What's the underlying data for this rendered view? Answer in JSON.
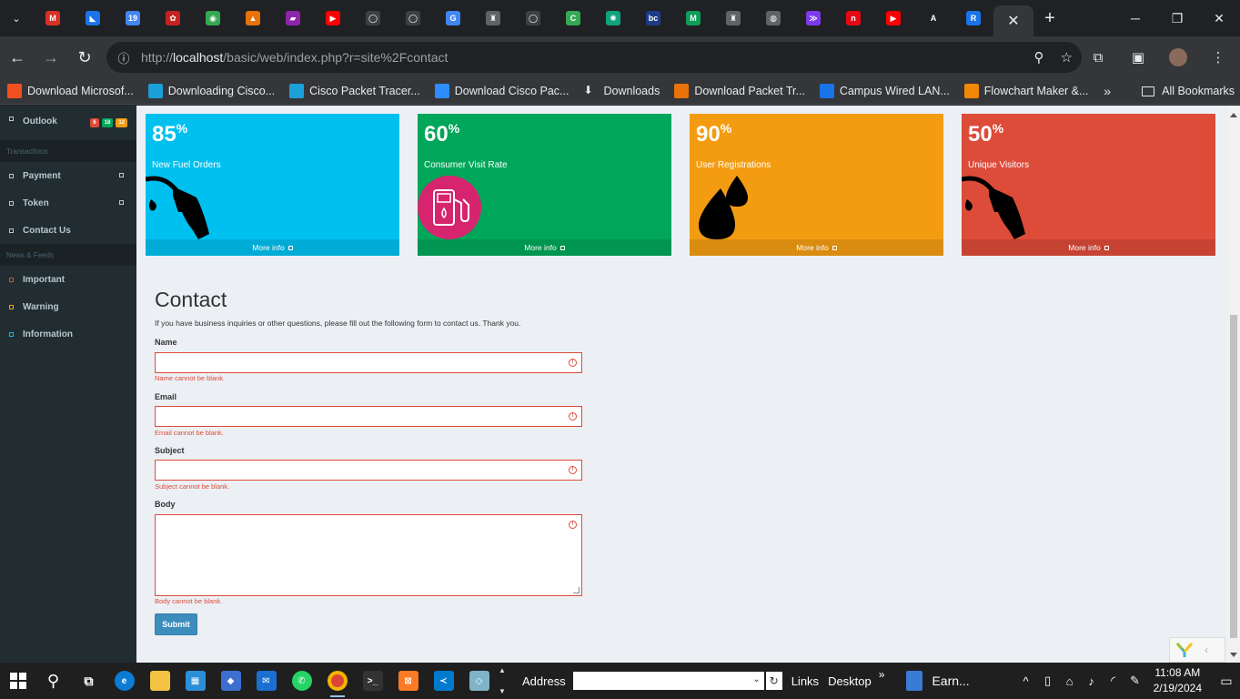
{
  "browser": {
    "tab_favicons": [
      {
        "name": "gmail-tab",
        "glyph": "M",
        "color": "#d93025"
      },
      {
        "name": "app-tab-1",
        "glyph": "◣",
        "color": "#1a73e8"
      },
      {
        "name": "calendar-tab",
        "glyph": "19",
        "color": "#4285f4"
      },
      {
        "name": "app-tab-2",
        "glyph": "✿",
        "color": "#c5221f"
      },
      {
        "name": "app-tab-3",
        "glyph": "◉",
        "color": "#34a853"
      },
      {
        "name": "app-tab-4",
        "glyph": "▲",
        "color": "#e8710a"
      },
      {
        "name": "app-tab-5",
        "glyph": "▰",
        "color": "#8e24aa"
      },
      {
        "name": "youtube-tab",
        "glyph": "▶",
        "color": "#ff0000"
      },
      {
        "name": "github-tab-1",
        "glyph": "◯",
        "color": "#3c4043"
      },
      {
        "name": "github-tab-2",
        "glyph": "◯",
        "color": "#3c4043"
      },
      {
        "name": "translate-tab",
        "glyph": "G",
        "color": "#4285f4"
      },
      {
        "name": "app-tab-6",
        "glyph": "♜",
        "color": "#5f6368"
      },
      {
        "name": "github-tab-3",
        "glyph": "◯",
        "color": "#3c4043"
      },
      {
        "name": "app-tab-7",
        "glyph": "C",
        "color": "#34a853"
      },
      {
        "name": "chatgpt-tab",
        "glyph": "✺",
        "color": "#10a37f"
      },
      {
        "name": "app-tab-8",
        "glyph": "bc",
        "color": "#1e3a8a"
      },
      {
        "name": "app-tab-9",
        "glyph": "M",
        "color": "#0f9d58"
      },
      {
        "name": "app-tab-10",
        "glyph": "♜",
        "color": "#5f6368"
      },
      {
        "name": "globe-tab",
        "glyph": "◍",
        "color": "#5f6368"
      },
      {
        "name": "app-tab-11",
        "glyph": "≫",
        "color": "#7c3aed"
      },
      {
        "name": "app-tab-12",
        "glyph": "n",
        "color": "#e50914"
      },
      {
        "name": "youtube-tab-2",
        "glyph": "▶",
        "color": "#ff0000"
      },
      {
        "name": "app-tab-13",
        "glyph": "A",
        "color": "#202124"
      },
      {
        "name": "app-tab-14",
        "glyph": "R",
        "color": "#1a73e8"
      }
    ],
    "active_tab_close": "✕",
    "new_tab": "+",
    "url_prefix": "http://",
    "url_host": "localhost",
    "url_path": "/basic/web/index.php?r=site%2Fcontact",
    "bookmarks": [
      {
        "label": "Download Microsof...",
        "color": "#f25022"
      },
      {
        "label": "Downloading Cisco...",
        "color": "#1ba0d7"
      },
      {
        "label": "Cisco Packet Tracer...",
        "color": "#1ba0d7"
      },
      {
        "label": "Download Cisco Pac...",
        "color": "#2d8cff"
      },
      {
        "label": "Downloads",
        "color": "#35363a"
      },
      {
        "label": "Download Packet Tr...",
        "color": "#e8710a"
      },
      {
        "label": "Campus Wired LAN...",
        "color": "#1a73e8"
      },
      {
        "label": "Flowchart Maker &...",
        "color": "#f08705"
      }
    ],
    "bookmarks_more": "»",
    "all_bookmarks": "All Bookmarks"
  },
  "sidebar": {
    "items_top": [
      {
        "label": "Outlook",
        "badges": [
          {
            "text": "6",
            "color": "#dd4b39"
          },
          {
            "text": "18",
            "color": "#00a65a"
          },
          {
            "text": "12",
            "color": "#f39c12"
          }
        ]
      }
    ],
    "header_transactions": "Transactions",
    "items_transactions": [
      {
        "label": "Payment"
      },
      {
        "label": "Token"
      },
      {
        "label": "Contact Us"
      }
    ],
    "header_news": "News & Feeds",
    "items_news": [
      {
        "label": "Important",
        "color": "#dd4b39"
      },
      {
        "label": "Warning",
        "color": "#f39c12"
      },
      {
        "label": "Information",
        "color": "#00c0ef"
      }
    ]
  },
  "stat_boxes": [
    {
      "value": "85",
      "unit": "%",
      "label": "New Fuel Orders",
      "footer": "More info",
      "color": "#00c0ef",
      "icon": "fuel-pump-icon"
    },
    {
      "value": "60",
      "unit": "%",
      "label": "Consumer Visit Rate",
      "footer": "More info",
      "color": "#00a65a",
      "icon": "fuel-station-icon"
    },
    {
      "value": "90",
      "unit": "%",
      "label": "User Registrations",
      "footer": "More info",
      "color": "#f39c12",
      "icon": "oil-drops-icon"
    },
    {
      "value": "50",
      "unit": "%",
      "label": "Unique Visitors",
      "footer": "More info",
      "color": "#dd4b39",
      "icon": "fuel-pump-icon"
    }
  ],
  "contact": {
    "title": "Contact",
    "lead": "If you have business inquiries or other questions, please fill out the following form to contact us. Thank you.",
    "fields": {
      "name": {
        "label": "Name",
        "value": "",
        "error": "Name cannot be blank."
      },
      "email": {
        "label": "Email",
        "value": "",
        "error": "Email cannot be blank."
      },
      "subject": {
        "label": "Subject",
        "value": "",
        "error": "Subject cannot be blank."
      },
      "body": {
        "label": "Body",
        "value": "",
        "error": "Body cannot be blank."
      }
    },
    "submit": "Submit"
  },
  "taskbar": {
    "address_label": "Address",
    "links_label": "Links",
    "desktop_label": "Desktop",
    "open_doc": "Earn...",
    "time": "11:08 AM",
    "date": "2/19/2024"
  }
}
